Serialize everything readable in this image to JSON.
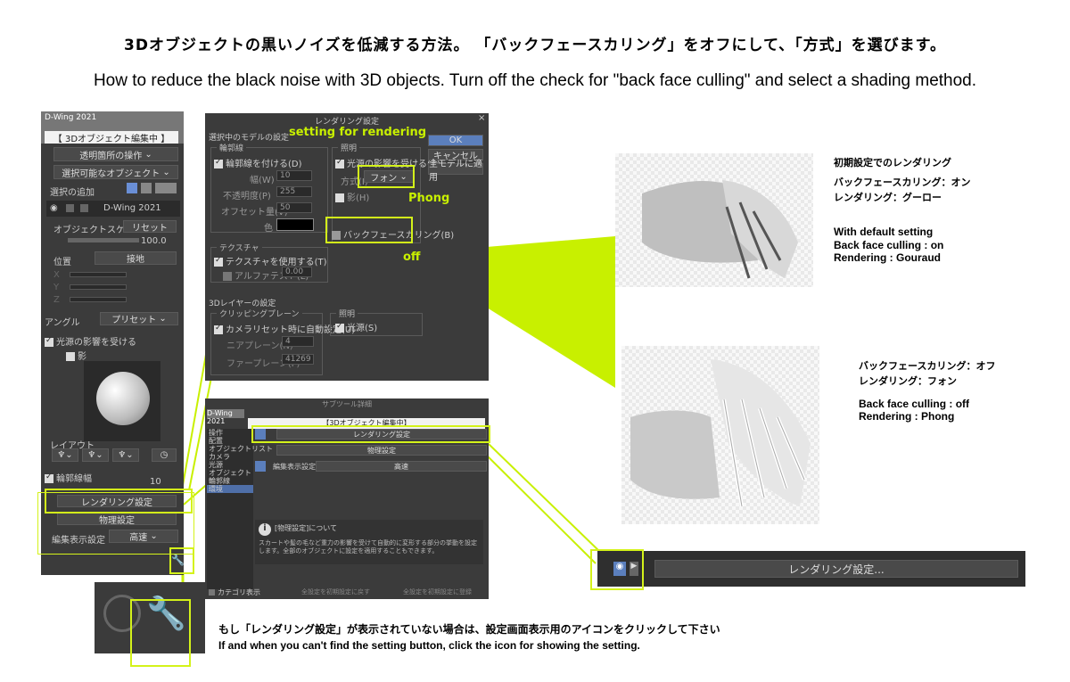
{
  "headings": {
    "jp": "3Dオブジェクトの黒いノイズを低減する方法。 「バックフェースカリング」をオフにして、「方式」を選びます。",
    "en": "How to reduce the black noise with 3D objects.   Turn off the check for \"back face culling\" and select a shading method."
  },
  "left_panel": {
    "version": "D-Wing 2021",
    "mode": "【 3Dオブジェクト編集中 】",
    "dropdown1": "透明箇所の操作",
    "dropdown2": "選択可能なオブジェクト",
    "add_selection": "選択の追加",
    "layer_name": "D-Wing 2021",
    "object_scale": "オブジェクトスケール",
    "reset": "リセット",
    "scale_value": "100.0",
    "position": "位置",
    "ground": "接地",
    "x": "X",
    "y": "Y",
    "z": "Z",
    "angle": "アングル",
    "preset": "プリセット",
    "light_affect": "光源の影響を受ける",
    "shadow": "影",
    "layout": "レイアウト",
    "outline_width": "輪郭線幅",
    "outline_value": "10",
    "render_settings": "レンダリング設定",
    "physics_settings": "物理設定",
    "edit_display": "編集表示設定",
    "edit_display_value": "高速"
  },
  "dialog": {
    "title": "レンダリング設定",
    "close": "×",
    "model_settings": "選択中のモデルの設定",
    "outline": "輪郭線",
    "add_outline": "輪郭線を付ける(D)",
    "width_label": "幅(W)",
    "width_value": "10",
    "opacity_label": "不透明度(P)",
    "opacity_value": "255",
    "offset_label": "オフセット量(V)",
    "offset_value": "50",
    "color_label": "色",
    "lighting": "照明",
    "receive_light": "光源の影響を受ける(A)",
    "method_label": "方式(I)",
    "method_value": "フォン",
    "shadow": "影(H)",
    "backface": "バックフェースカリング(B)",
    "texture": "テクスチャ",
    "use_texture": "テクスチャを使用する(T)",
    "alpha_test": "アルファテスト(L)",
    "alpha_value": "0.00",
    "layer_settings": "3Dレイヤーの設定",
    "clipping": "クリッピングプレーン",
    "auto_camera": "カメラリセット時に自動設定(U)",
    "near": "ニアプレーン(N)",
    "near_value": "4",
    "far": "ファープレーン(F)",
    "far_value": "41269",
    "light2": "照明",
    "light_source": "光源(S)",
    "ok": "OK",
    "cancel": "キャンセル",
    "apply_all": "全モデルに適用",
    "ann_setting": "setting for rendering",
    "ann_phong": "Phong",
    "ann_off": "off"
  },
  "tool_dialog": {
    "title": "サブツール詳細",
    "name": "D-Wing 2021",
    "mode": "【3Dオブジェクト編集中】",
    "categories": [
      "操作",
      "配置",
      "オブジェクトリスト",
      "カメラ",
      "光源",
      "オブジェクト",
      "輪郭線",
      "環境"
    ],
    "render_settings": "レンダリング設定",
    "physics": "物理設定",
    "edit_display": "編集表示設定",
    "edit_display_value": "高速",
    "info_title": "[物理設定]について",
    "info_text": "スカートや髪の毛など重力の影響を受けて自動的に変形する部分の挙動を設定します。全部のオブジェクトに設定を適用することもできます。",
    "show_category": "カテゴリ表示",
    "reset_all": "全設定を初期設定に戻す",
    "save_all": "全設定を初期設定に登録"
  },
  "render1": {
    "jp_title": "初期設定でのレンダリング",
    "jp_line1": "バックフェースカリング：オン",
    "jp_line2": "レンダリング：グーロー",
    "en_title": "With default setting",
    "en_line1": "Back face culling : on",
    "en_line2": "Rendering : Gouraud"
  },
  "render2": {
    "jp_line1": "バックフェースカリング：オフ",
    "jp_line2": "レンダリング：フォン",
    "en_line1": "Back face culling : off",
    "en_line2": "Rendering : Phong"
  },
  "zoom_bar": {
    "render_settings": "レンダリング設定..."
  },
  "bottom_note": {
    "jp": "もし「レンダリング設定」が表示されていない場合は、設定画面表示用のアイコンをクリックして下さい",
    "en": "If and when you can't find the setting button, click the icon for showing the setting."
  },
  "colors": {
    "accent": "#d4f21a",
    "panel": "#3b3b3b",
    "annotation_text": "#c8f000"
  }
}
